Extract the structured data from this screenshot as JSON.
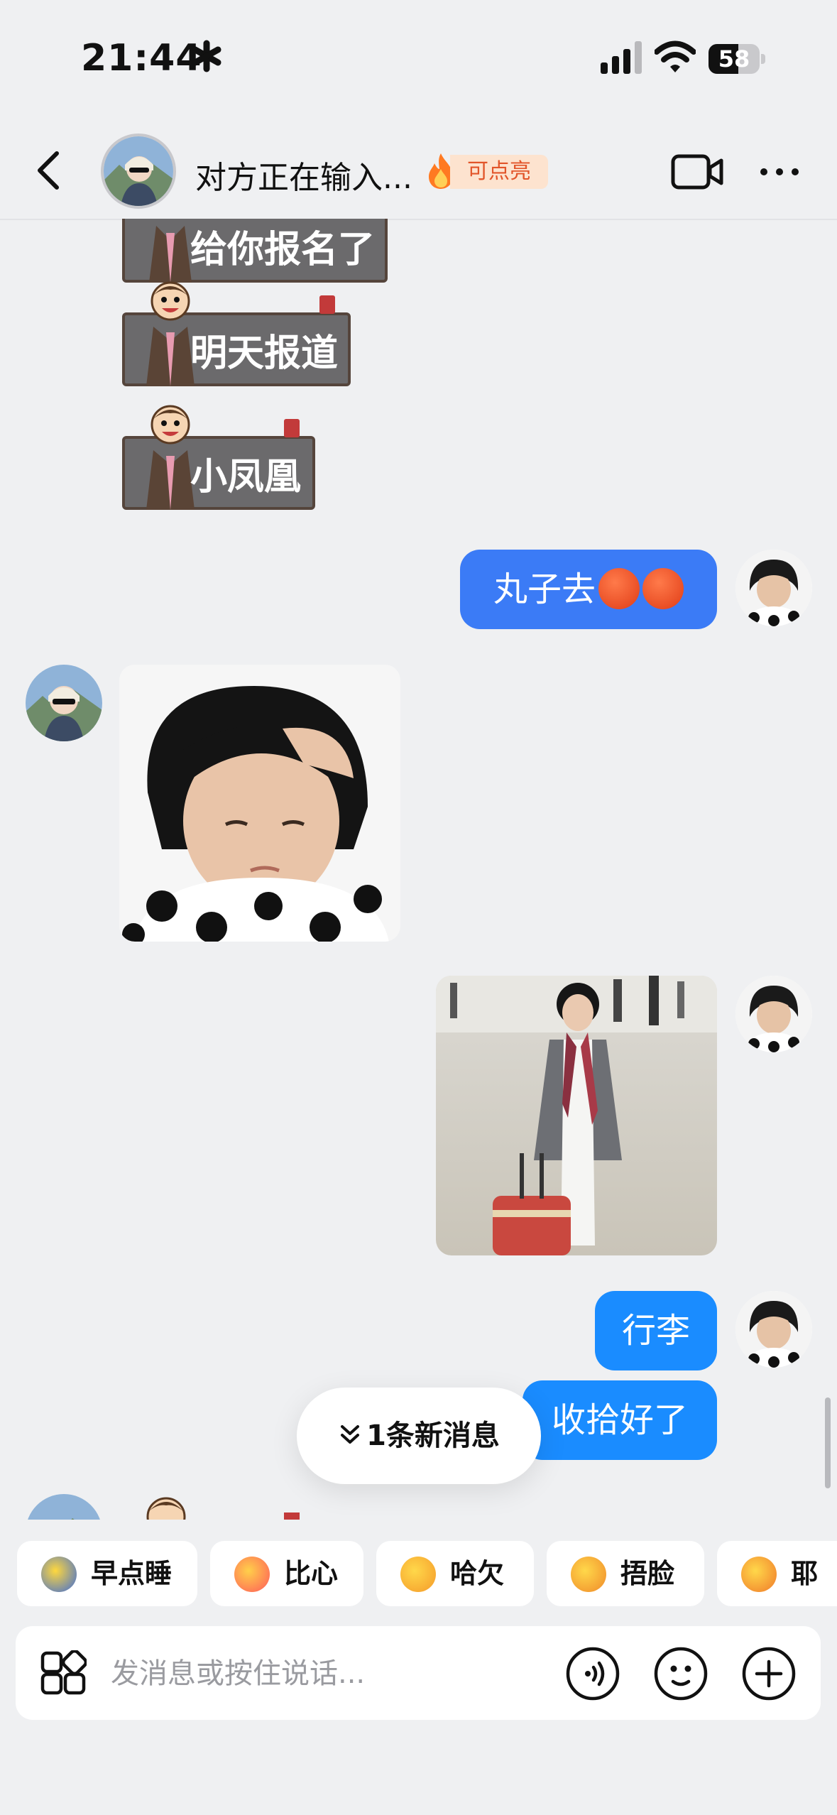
{
  "status_bar": {
    "time": "21:44",
    "battery": "58",
    "battery_level": 0.58
  },
  "header": {
    "title": "对方正在输入...",
    "spark_badge": "可点亮",
    "icons": [
      "back-arrow-icon",
      "fire-icon",
      "video-call-icon",
      "more-icon"
    ]
  },
  "messages": [
    {
      "side": "left",
      "type": "sticker",
      "text": "给你报名了"
    },
    {
      "side": "left",
      "type": "sticker",
      "text": "明天报道"
    },
    {
      "side": "left",
      "type": "sticker",
      "text": "小凤凰"
    },
    {
      "side": "right",
      "type": "text",
      "text": "丸子去",
      "emoji": [
        "angry-face",
        "angry-face"
      ]
    },
    {
      "side": "left",
      "type": "image",
      "description_icon": "photo"
    },
    {
      "side": "right",
      "type": "image",
      "description_icon": "photo"
    },
    {
      "side": "right",
      "type": "text",
      "text": "行李"
    },
    {
      "side": "right",
      "type": "text",
      "text": "收拾好了"
    }
  ],
  "new_messages": "1条新消息",
  "quick_reactions": [
    {
      "label": "早点睡",
      "icon": "sleepy-moon-icon"
    },
    {
      "label": "比心",
      "icon": "heart-hands-icon"
    },
    {
      "label": "哈欠",
      "icon": "yawn-icon"
    },
    {
      "label": "捂脸",
      "icon": "facepalm-icon"
    },
    {
      "label": "耶",
      "icon": "yeah-icon"
    }
  ],
  "input": {
    "placeholder": "发消息或按住说话..."
  },
  "colors": {
    "bubble_blue": "#3b7bf6",
    "bubble_cyan": "#1a8cff",
    "background": "#eff0f2",
    "spark_text": "#e2552a"
  }
}
